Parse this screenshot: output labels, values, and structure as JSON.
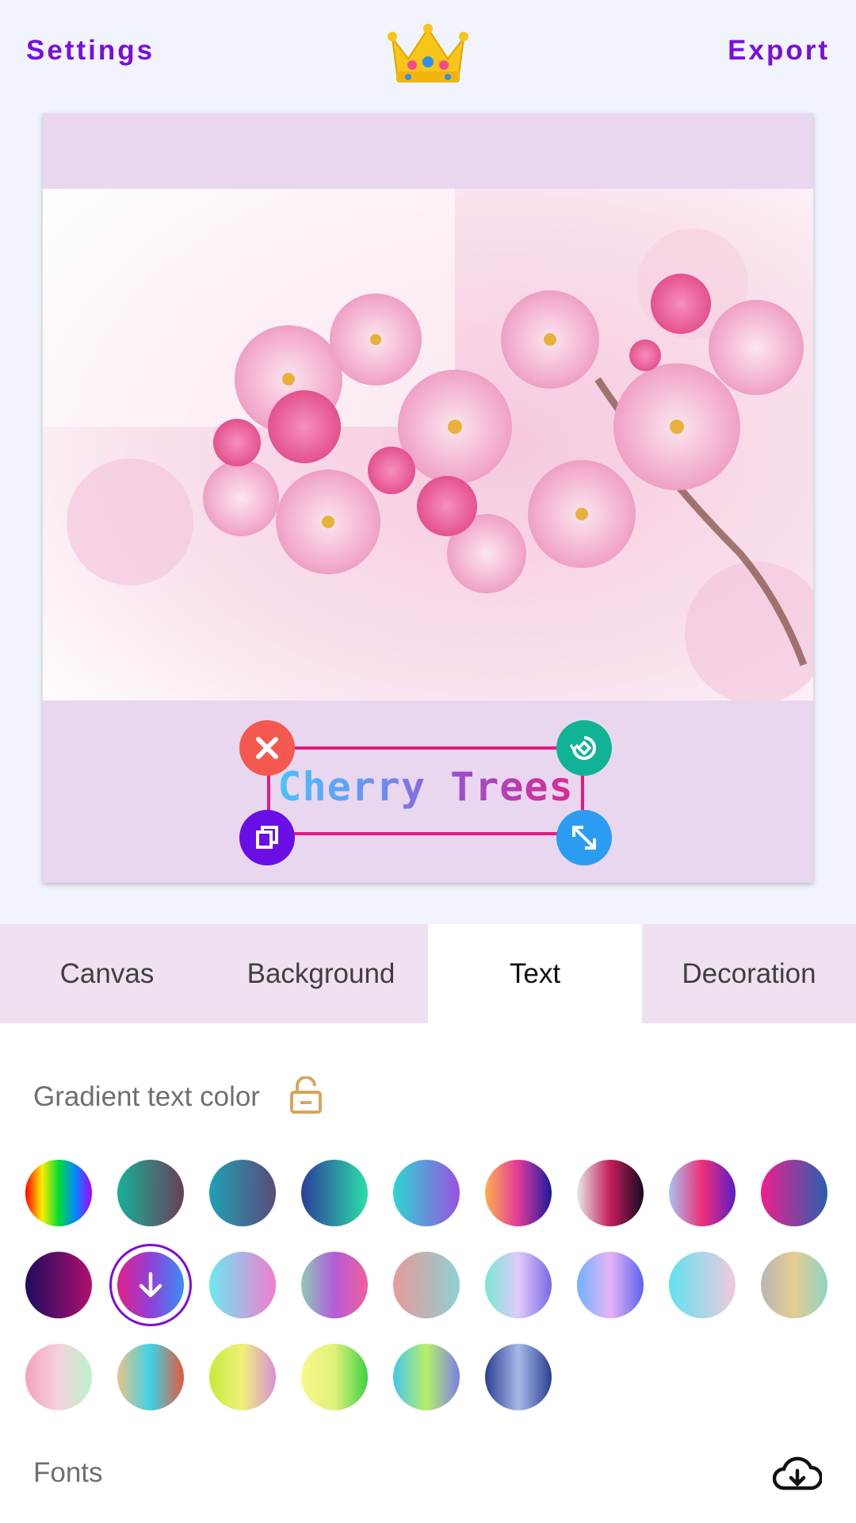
{
  "header": {
    "settings_label": "Settings",
    "export_label": "Export",
    "logo_icon": "crown-icon"
  },
  "canvas": {
    "background_color": "#e9d7f0",
    "photo": "pink-cherry-blossom-photo",
    "text": "Cherry Trees",
    "text_gradient": [
      "#48c6ff",
      "#6a8ff0",
      "#9b4fd0",
      "#e0268f"
    ],
    "handles": {
      "delete": {
        "icon": "close-icon",
        "color": "#f4584f"
      },
      "rotate": {
        "icon": "rotate-icon",
        "color": "#11b397"
      },
      "duplicate": {
        "icon": "duplicate-icon",
        "color": "#6a0ee6"
      },
      "resize": {
        "icon": "resize-icon",
        "color": "#2b9cf2"
      }
    }
  },
  "tabs": [
    {
      "label": "Canvas",
      "active": false
    },
    {
      "label": "Background",
      "active": false
    },
    {
      "label": "Text",
      "active": true
    },
    {
      "label": "Decoration",
      "active": false
    }
  ],
  "gradient_section": {
    "title": "Gradient text color",
    "lock_icon": "unlock-icon",
    "selected_index": 10,
    "swatches": [
      [
        "#ff0000",
        "#ffee00",
        "#00dd33",
        "#0088ff",
        "#aa00ff"
      ],
      [
        "#18b09a",
        "#6a3d58"
      ],
      [
        "#1ea1b4",
        "#5b4a7a"
      ],
      [
        "#2b3d9c",
        "#2be0a8"
      ],
      [
        "#2cd6d0",
        "#9b4fe0"
      ],
      [
        "#ffae4f",
        "#e03a9a",
        "#1a1aa0"
      ],
      [
        "#e8e8e8",
        "#c21d5b",
        "#150a1f"
      ],
      [
        "#a7c2f3",
        "#f02e78",
        "#5a1cc9"
      ],
      [
        "#ef1f8d",
        "#2a5fae"
      ],
      [
        "#1e0b5f",
        "#b0106e"
      ],
      [
        "#e01f8a",
        "#9041d8",
        "#3a8ef5"
      ],
      [
        "#6ce8f2",
        "#f27ccd"
      ],
      [
        "#8ec9b8",
        "#b35cd8",
        "#f25f9a"
      ],
      [
        "#e79a9a",
        "#8fd0d3"
      ],
      [
        "#7ae8d4",
        "#e0cbf8",
        "#7c66e9"
      ],
      [
        "#6fb2ff",
        "#e7b4f5",
        "#5b62f0"
      ],
      [
        "#5fe2f0",
        "#f3c9dd"
      ],
      [
        "#b7b8b4",
        "#e6cc92",
        "#8ed4c3"
      ],
      [
        "#f2a1bd",
        "#f6d3dc",
        "#b9f2c9"
      ],
      [
        "#e7c58a",
        "#3fd1e5",
        "#e4593b"
      ],
      [
        "#c7ea3c",
        "#f0f07a",
        "#d98fd6"
      ],
      [
        "#f6f98a",
        "#e1f07a",
        "#3ad441"
      ],
      [
        "#44c6e9",
        "#b8f06a",
        "#7b7fe7"
      ],
      [
        "#2b3f93",
        "#a7b9e8",
        "#2b3f93"
      ]
    ]
  },
  "fonts_section": {
    "title": "Fonts",
    "download_icon": "cloud-download-icon"
  }
}
